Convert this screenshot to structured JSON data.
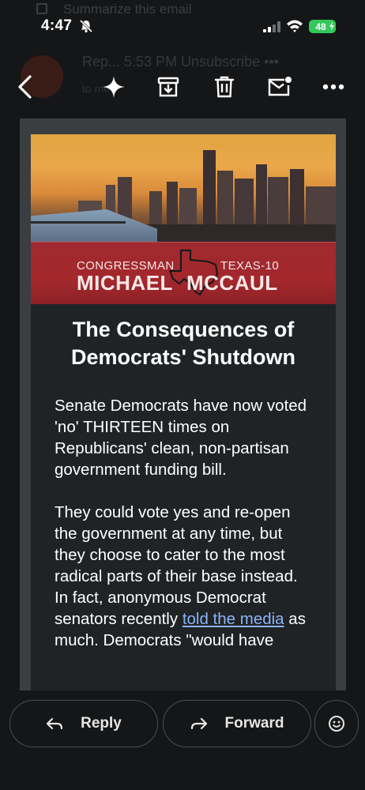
{
  "status_bar": {
    "time": "4:47",
    "battery": "48"
  },
  "background_ghost": {
    "summarize": "Summarize this email",
    "sender": "Rep...   5:53 PM   Unsubscribe   •••",
    "sub": "to me"
  },
  "toolbar": {
    "back": "back-arrow-icon",
    "sparkle": "sparkle-icon",
    "archive": "archive-icon",
    "delete": "trash-icon",
    "mark_unread": "mark-unread-icon",
    "more": "more-vert-icon"
  },
  "email": {
    "banner_left": "CONGRESSMAN",
    "banner_right": "TEXAS-10",
    "banner_name_first": "MICHAEL",
    "banner_name_last": "MCCAUL",
    "title": "The Consequences of Democrats' Shutdown",
    "para1": "Senate Democrats have now voted 'no' THIRTEEN times on Republicans' clean, non-partisan government funding bill.",
    "para2_before": "They could vote yes and re-open the government at any time, but they choose to cater to the most radical parts of their base instead. In fact, anonymous Democrat senators recently ",
    "para2_link": "told the media",
    "para2_after": " as much. Democrats \"would have"
  },
  "bottom_bar": {
    "reply_label": "Reply",
    "forward_label": "Forward"
  },
  "colors": {
    "background": "#151617",
    "banner_red": "#a4282c",
    "link": "#8ab4f8",
    "battery_green": "#34c759"
  }
}
